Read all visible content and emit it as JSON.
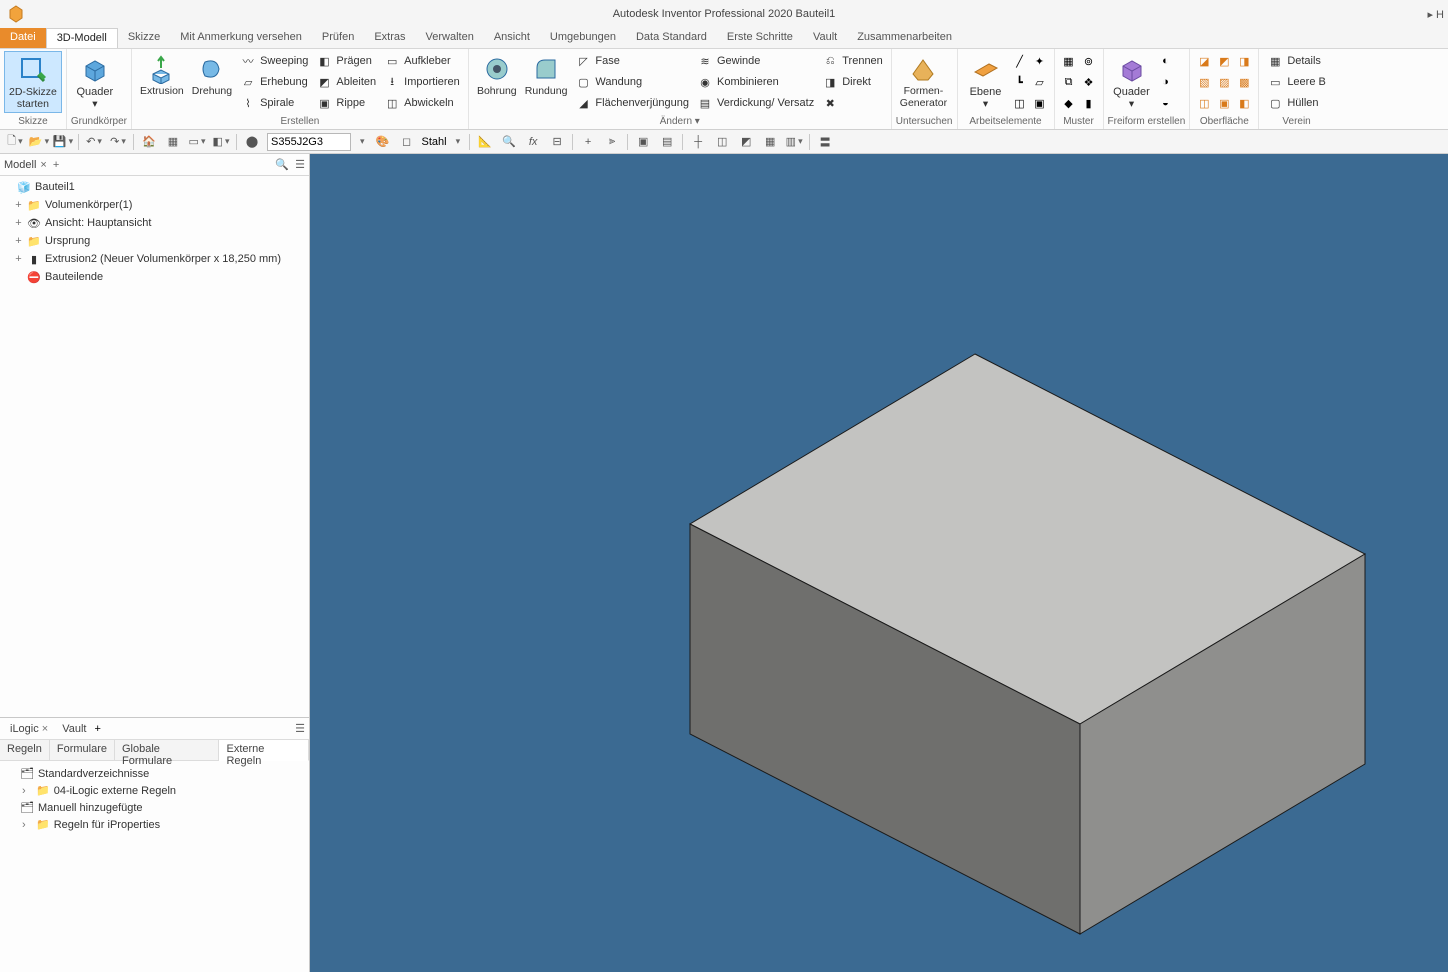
{
  "title": "Autodesk Inventor Professional 2020   Bauteil1",
  "topright": "▸  H",
  "menu": {
    "file": "Datei",
    "tabs": [
      "3D-Modell",
      "Skizze",
      "Mit Anmerkung versehen",
      "Prüfen",
      "Extras",
      "Verwalten",
      "Ansicht",
      "Umgebungen",
      "Data Standard",
      "Erste Schritte",
      "Vault",
      "Zusammenarbeiten"
    ]
  },
  "ribbon": {
    "skizze": {
      "btn": "2D-Skizze\nstarten",
      "label": "Skizze"
    },
    "grundkorper": {
      "btn": "Quader",
      "label": "Grundkörper"
    },
    "erstellen": {
      "extrusion": "Extrusion",
      "drehung": "Drehung",
      "col1": [
        "Sweeping",
        "Erhebung",
        "Spirale"
      ],
      "col2": [
        "Prägen",
        "Ableiten",
        "Rippe"
      ],
      "col3": [
        "Aufkleber",
        "Importieren",
        "Abwickeln"
      ],
      "label": "Erstellen"
    },
    "andern": {
      "bohrung": "Bohrung",
      "rundung": "Rundung",
      "col1": [
        "Fase",
        "Wandung",
        "Flächenverjüngung"
      ],
      "col2": [
        "Gewinde",
        "Kombinieren",
        "Verdickung/ Versatz"
      ],
      "col3": [
        "Trennen",
        "Direkt"
      ],
      "label": "Ändern ▾"
    },
    "untersuchen": {
      "btn": "Formen-\nGenerator",
      "label": "Untersuchen"
    },
    "arbeitselemente": {
      "btn": "Ebene",
      "label": "Arbeitselemente"
    },
    "muster": {
      "label": "Muster"
    },
    "freiform": {
      "btn": "Quader",
      "label": "Freiform erstellen"
    },
    "oberflache": {
      "label": "Oberfläche"
    },
    "verein": {
      "details": "Details",
      "leere": "Leere B",
      "hullen": "Hüllen",
      "label": "Verein"
    }
  },
  "qat": {
    "material_code": "S355J2G3",
    "material_name": "Stahl"
  },
  "model_panel": {
    "title": "Modell",
    "root": "Bauteil1",
    "items": [
      "Volumenkörper(1)",
      "Ansicht: Hauptansicht",
      "Ursprung",
      "Extrusion2 (Neuer Volumenkörper x 18,250 mm)",
      "Bauteilende"
    ]
  },
  "ilogic": {
    "tabs": [
      "iLogic",
      "Vault"
    ],
    "subtabs": [
      "Regeln",
      "Formulare",
      "Globale Formulare",
      "Externe Regeln"
    ],
    "active_subtab": 3,
    "rows": [
      {
        "lvl": 0,
        "exp": "",
        "text": "Standardverzeichnisse"
      },
      {
        "lvl": 1,
        "exp": "›",
        "text": "04-iLogic externe Regeln"
      },
      {
        "lvl": 0,
        "exp": "",
        "text": "Manuell hinzugefügte"
      },
      {
        "lvl": 1,
        "exp": "›",
        "text": "Regeln für iProperties"
      }
    ]
  }
}
